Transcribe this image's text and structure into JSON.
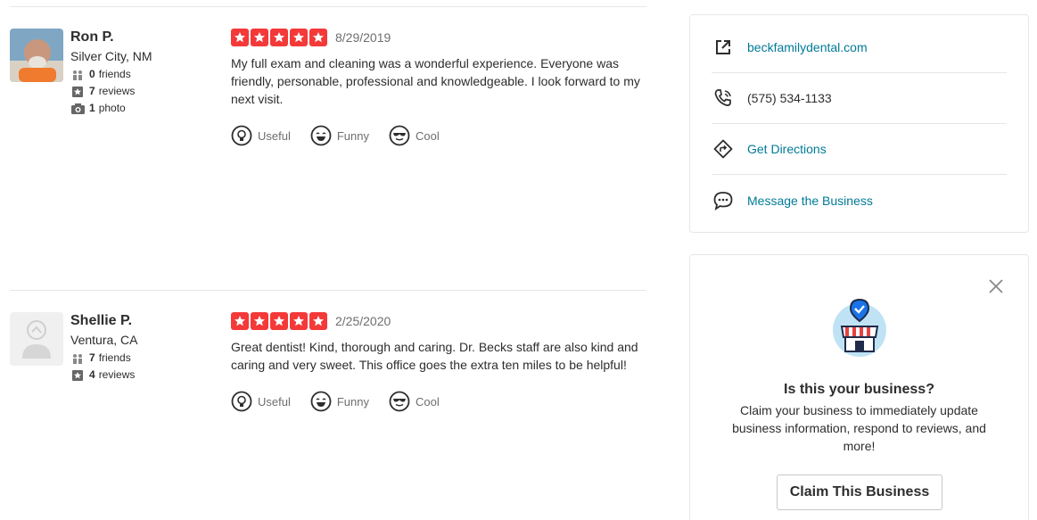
{
  "reviews": [
    {
      "name": "Ron P.",
      "location": "Silver City, NM",
      "friends_count": "0",
      "friends_label": "friends",
      "reviews_count": "7",
      "reviews_label": "reviews",
      "photos_count": "1",
      "photos_label": "photo",
      "rating": 5,
      "date": "8/29/2019",
      "text": "My full exam and cleaning was a wonderful experience. Everyone was friendly, personable, professional and knowledgeable.  I look forward to my next visit.",
      "actions": {
        "useful": "Useful",
        "funny": "Funny",
        "cool": "Cool"
      }
    },
    {
      "name": "Shellie P.",
      "location": "Ventura, CA",
      "friends_count": "7",
      "friends_label": "friends",
      "reviews_count": "4",
      "reviews_label": "reviews",
      "rating": 5,
      "date": "2/25/2020",
      "text": "Great dentist!  Kind, thorough and caring.  Dr. Becks staff are also kind and caring and very sweet.  This office goes the extra ten miles to be helpful!",
      "actions": {
        "useful": "Useful",
        "funny": "Funny",
        "cool": "Cool"
      }
    }
  ],
  "business_info": {
    "website": "beckfamilydental.com",
    "phone": "(575) 534-1133",
    "directions": "Get Directions",
    "message": "Message the Business"
  },
  "claim": {
    "title": "Is this your business?",
    "description": "Claim your business to immediately update business information, respond to reviews, and more!",
    "button": "Claim This Business"
  },
  "colors": {
    "star_red": "#f43939",
    "link_teal": "#027a97",
    "text_dark": "#2d2d2d"
  }
}
